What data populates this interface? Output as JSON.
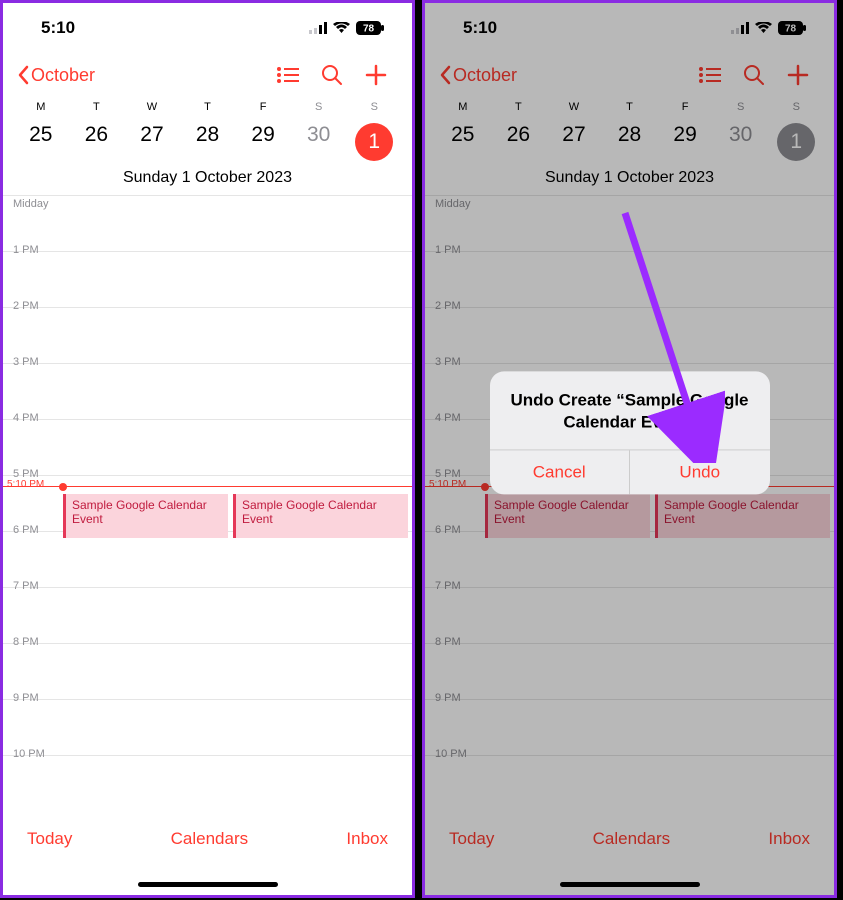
{
  "status": {
    "time": "5:10",
    "battery": "78"
  },
  "nav": {
    "back": "October"
  },
  "week": {
    "days": [
      "M",
      "T",
      "W",
      "T",
      "F",
      "S",
      "S"
    ],
    "nums": [
      "25",
      "26",
      "27",
      "28",
      "29",
      "30",
      "1"
    ]
  },
  "dateTitle": "Sunday  1 October 2023",
  "hours": [
    "Midday",
    "1 PM",
    "2 PM",
    "3 PM",
    "4 PM",
    "5 PM",
    "6 PM",
    "7 PM",
    "8 PM",
    "9 PM",
    "10 PM"
  ],
  "nowLabel": "5:10 PM",
  "events": [
    {
      "title": "Sample Google Calendar Event"
    },
    {
      "title": "Sample Google Calendar Event"
    }
  ],
  "toolbar": {
    "today": "Today",
    "calendars": "Calendars",
    "inbox": "Inbox"
  },
  "alert": {
    "title": "Undo Create “Sample Google Calendar Event”",
    "cancel": "Cancel",
    "undo": "Undo"
  }
}
